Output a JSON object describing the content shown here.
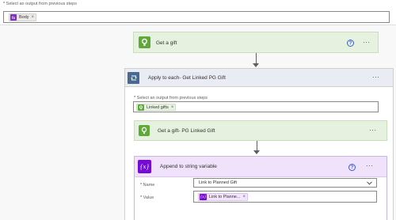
{
  "top": {
    "label": "Select an output from previous steps",
    "required_mark": "*",
    "token": {
      "label": "Body",
      "icon": "expression-icon",
      "color": "#7b34b8"
    }
  },
  "get_gift": {
    "title": "Get a gift",
    "icon": "gift-connector-icon",
    "color": "#5fa83a",
    "help": "?",
    "more": "···"
  },
  "apply_each": {
    "title": "Apply to each- Get Linked PG Gift",
    "icon": "loop-icon",
    "color": "#486991",
    "more": "···",
    "label": "Select an output from previous steps",
    "required_mark": "*",
    "token": {
      "label": "Linked gifts",
      "icon": "gift-connector-icon",
      "color": "#5fa83a"
    }
  },
  "get_gift_pg": {
    "title": "Get a gift- PG Linked Gift",
    "icon": "gift-connector-icon",
    "color": "#5fa83a",
    "more": "···"
  },
  "append": {
    "title": "Append to string variable",
    "icon": "variable-icon",
    "icon_text": "{x}",
    "color": "#770bd6",
    "help": "?",
    "more": "···",
    "name_label": "Name",
    "name_value": "Link to Planned Gift",
    "value_label": "Value",
    "required_mark": "*",
    "value_token": {
      "label": "Link to Planne...",
      "icon_text": "{x}",
      "color": "#770bd6"
    }
  }
}
